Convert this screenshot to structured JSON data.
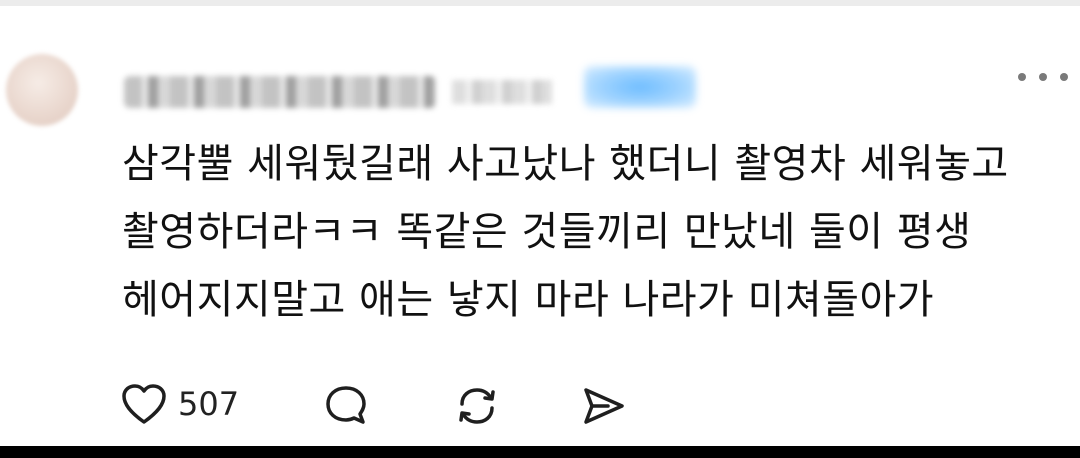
{
  "comment": {
    "lines": [
      "삼각뿔 세워뒀길래 사고났나 했더니 촬영차 세워놓고",
      "촬영하더라ㅋㅋ 똑같은 것들끼리 만났네 둘이 평생",
      "헤어지지말고 애는 낳지 마라 나라가 미쳐돌아가"
    ]
  },
  "actions": {
    "like_count": "507",
    "icons": [
      "heart-icon",
      "comment-icon",
      "repost-icon",
      "send-icon"
    ]
  },
  "colors": {
    "text": "#111111",
    "icon": "#1f1f1f",
    "background": "#ffffff"
  }
}
